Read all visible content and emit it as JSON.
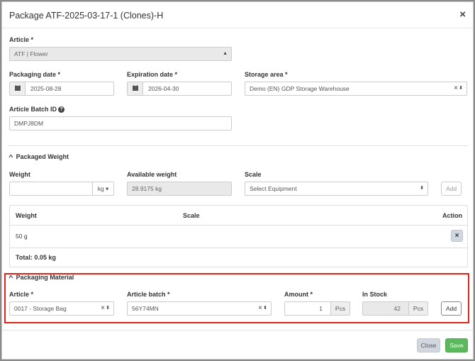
{
  "modal": {
    "title": "Package ATF-2025-03-17-1 (Clones)-H",
    "close_glyph": "×"
  },
  "article": {
    "label": "Article",
    "required": "*",
    "value": "ATF | Flower"
  },
  "packaging_date": {
    "label": "Packaging date",
    "required": "*",
    "value": "2025-08-28"
  },
  "expiration_date": {
    "label": "Expiration date",
    "required": "*",
    "value": "2026-04-30"
  },
  "storage_area": {
    "label": "Storage area",
    "required": "*",
    "value": "Demo (EN) GDP Storage Warehouse"
  },
  "batch_id": {
    "label": "Article Batch ID",
    "value": "DMPJ8DM"
  },
  "packaged_weight": {
    "title": "Packaged Weight",
    "weight_label": "Weight",
    "unit": "kg",
    "available_label": "Available weight",
    "available_value": "28.9175 kg",
    "scale_label": "Scale",
    "scale_placeholder": "Select Equipment",
    "add_label": "Add",
    "table": {
      "headers": [
        "Weight",
        "Scale",
        "Action"
      ],
      "rows": [
        {
          "weight": "50 g",
          "scale": ""
        }
      ],
      "total": "Total: 0.05 kg"
    }
  },
  "packaging_material": {
    "title": "Packaging Material",
    "article_label": "Article",
    "article_value": "0017 - Storage Bag",
    "batch_label": "Article batch",
    "batch_value": "56Y74MN",
    "amount_label": "Amount",
    "amount_value": "1",
    "amount_unit": "Pcs",
    "stock_label": "In Stock",
    "stock_value": "42",
    "stock_unit": "Pcs",
    "add_label": "Add",
    "required": "*"
  },
  "footer": {
    "close_label": "Close",
    "save_label": "Save"
  },
  "colors": {
    "highlight": "#e2231a",
    "save": "#5cb85c",
    "close": "#d2d6de"
  },
  "icons": {
    "calendar": "calendar-icon",
    "help": "question-circle-icon",
    "chevron": "chevron-up-icon"
  }
}
